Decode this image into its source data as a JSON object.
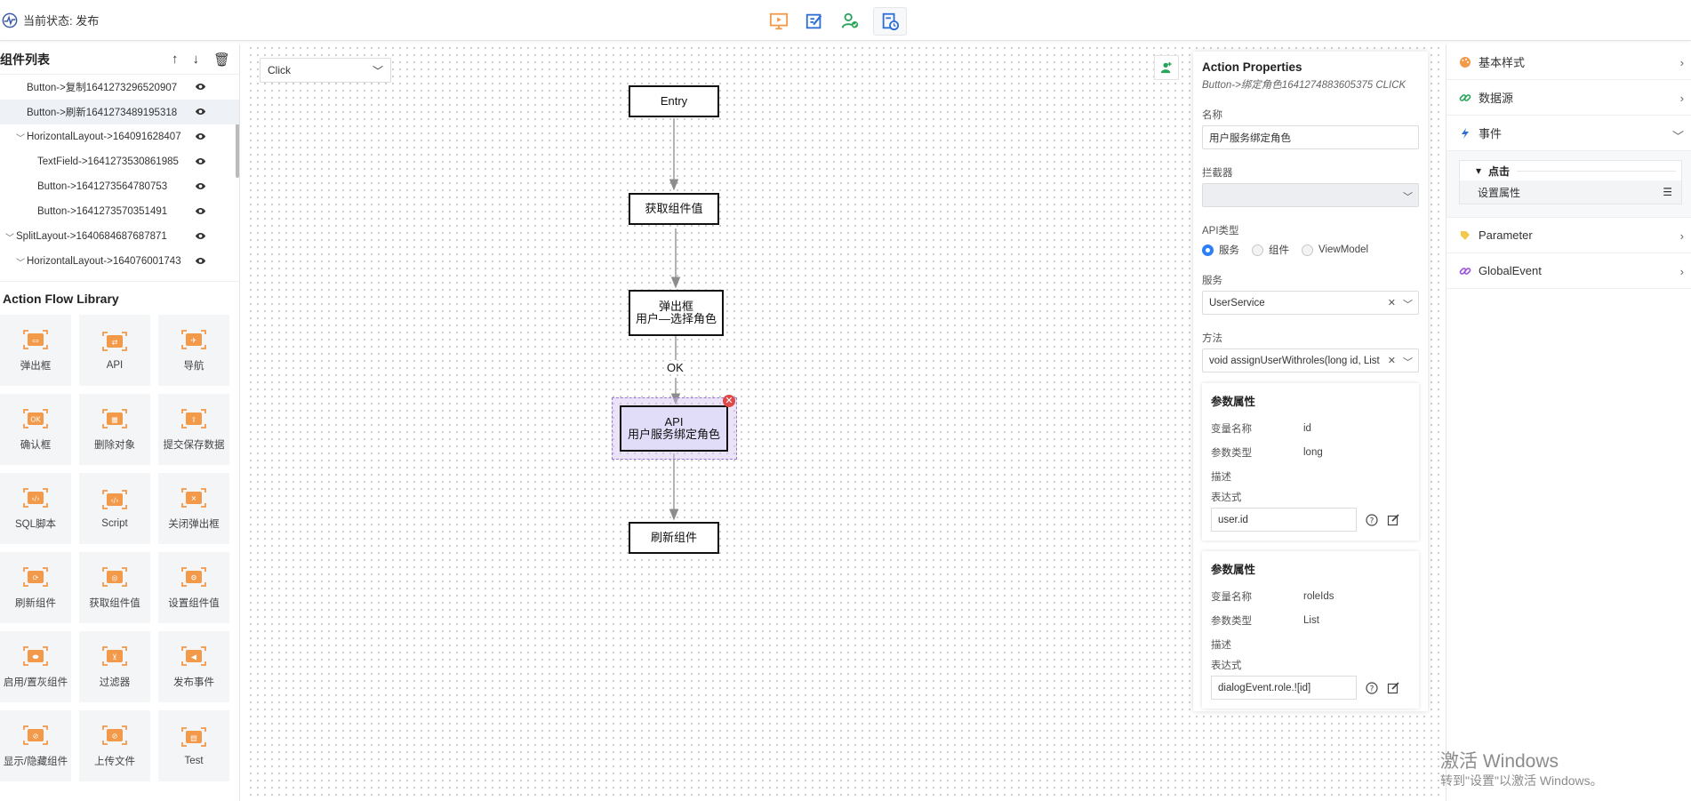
{
  "status": {
    "text": "当前状态: 发布"
  },
  "component_list": {
    "title": "组件列表",
    "items": [
      {
        "label": "Button->复制1641273296520907",
        "indent": 1,
        "caret": ""
      },
      {
        "label": "Button->刷新1641273489195318",
        "indent": 1,
        "caret": ""
      },
      {
        "label": "HorizontalLayout->164091628407",
        "indent": 1,
        "caret": "﹀"
      },
      {
        "label": "TextField->1641273530861985",
        "indent": 2,
        "caret": ""
      },
      {
        "label": "Button->1641273564780753",
        "indent": 2,
        "caret": ""
      },
      {
        "label": "Button->1641273570351491",
        "indent": 2,
        "caret": ""
      },
      {
        "label": "SplitLayout->1640684687687871",
        "indent": 0,
        "caret": "﹀"
      },
      {
        "label": "HorizontalLayout->164076001743",
        "indent": 1,
        "caret": "﹀"
      }
    ]
  },
  "library": {
    "title": "Action Flow Library",
    "items": [
      "弹出框",
      "API",
      "导航",
      "确认框",
      "删除对象",
      "提交保存数据",
      "SQL脚本",
      "Script",
      "关闭弹出框",
      "刷新组件",
      "获取组件值",
      "设置组件值",
      "启用/置灰组件",
      "过滤器",
      "发布事件",
      "显示/隐藏组件",
      "上传文件",
      "Test"
    ]
  },
  "canvas": {
    "event_value": "Click",
    "nodes": {
      "entry": "Entry",
      "get_value": "获取组件值",
      "dialog_line1": "弹出框",
      "dialog_line2": "用户—选择角色",
      "api_line1": "API",
      "api_line2": "用户服务绑定角色",
      "refresh": "刷新组件"
    },
    "edge_label": "OK",
    "delete_glyph": "✕"
  },
  "action_properties": {
    "title": "Action Properties",
    "subtitle": "Button->绑定角色1641274883605375 CLICK",
    "name_label": "名称",
    "name_value": "用户服务绑定角色",
    "interceptor_label": "拦截器",
    "api_type_label": "API类型",
    "api_types": [
      "服务",
      "组件",
      "ViewModel"
    ],
    "service_label": "服务",
    "service_value": "UserService",
    "method_label": "方法",
    "method_value": "void assignUserWithroles(long id, List",
    "params": [
      {
        "title": "参数属性",
        "var_label": "变量名称",
        "var_value": "id",
        "type_label": "参数类型",
        "type_value": "long",
        "desc_label": "描述",
        "expr_label": "表达式",
        "expr_value": "user.id"
      },
      {
        "title": "参数属性",
        "var_label": "变量名称",
        "var_value": "roleIds",
        "type_label": "参数类型",
        "type_value": "List",
        "desc_label": "描述",
        "expr_label": "表达式",
        "expr_value": "dialogEvent.role.![id]"
      }
    ]
  },
  "right_panel": {
    "basic_style": "基本样式",
    "data_source": "数据源",
    "events": "事件",
    "click_group": "点击",
    "set_property": "设置属性",
    "parameter": "Parameter",
    "global_event": "GlobalEvent"
  },
  "watermark": {
    "line1": "激活 Windows",
    "line2": "转到\"设置\"以激活 Windows。"
  },
  "colors": {
    "accent": "#f2994a",
    "select_blue": "#2d7ff9",
    "node_selected": "#e1dcf7"
  }
}
